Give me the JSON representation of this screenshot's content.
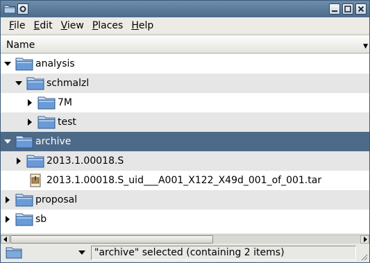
{
  "window": {
    "icons": [
      "folder-icon",
      "window-menu-icon"
    ],
    "controls": [
      "minimize-icon",
      "maximize-icon",
      "close-icon"
    ]
  },
  "menubar": {
    "items": [
      {
        "u": "F",
        "rest": "ile"
      },
      {
        "u": "E",
        "rest": "dit"
      },
      {
        "u": "V",
        "rest": "iew"
      },
      {
        "u": "P",
        "rest": "laces"
      },
      {
        "u": "H",
        "rest": "elp"
      }
    ]
  },
  "columns": {
    "name": "Name"
  },
  "tree": {
    "rows": [
      {
        "label": "analysis",
        "depth": 0,
        "state": "expanded",
        "icon": "folder-icon"
      },
      {
        "label": "schmalzl",
        "depth": 1,
        "state": "expanded",
        "icon": "folder-icon"
      },
      {
        "label": "7M",
        "depth": 2,
        "state": "collapsed",
        "icon": "folder-icon"
      },
      {
        "label": "test",
        "depth": 2,
        "state": "collapsed",
        "icon": "folder-icon"
      },
      {
        "label": "archive",
        "depth": 0,
        "state": "expanded",
        "icon": "folder-icon",
        "selected": true
      },
      {
        "label": "2013.1.00018.S",
        "depth": 1,
        "state": "collapsed",
        "icon": "folder-icon"
      },
      {
        "label": "2013.1.00018.S_uid___A001_X122_X49d_001_of_001.tar",
        "depth": 1,
        "state": "leaf",
        "icon": "archive-file-icon"
      },
      {
        "label": "proposal",
        "depth": 0,
        "state": "collapsed",
        "icon": "folder-icon"
      },
      {
        "label": "sb",
        "depth": 0,
        "state": "collapsed",
        "icon": "folder-icon"
      }
    ]
  },
  "statusbar": {
    "message": "\"archive\" selected (containing 2 items)",
    "combo_icon": "folder-icon"
  },
  "colors": {
    "selection": "#4d6a88",
    "alt_row": "#e6e6e6",
    "folder": "#6a9bd8"
  }
}
